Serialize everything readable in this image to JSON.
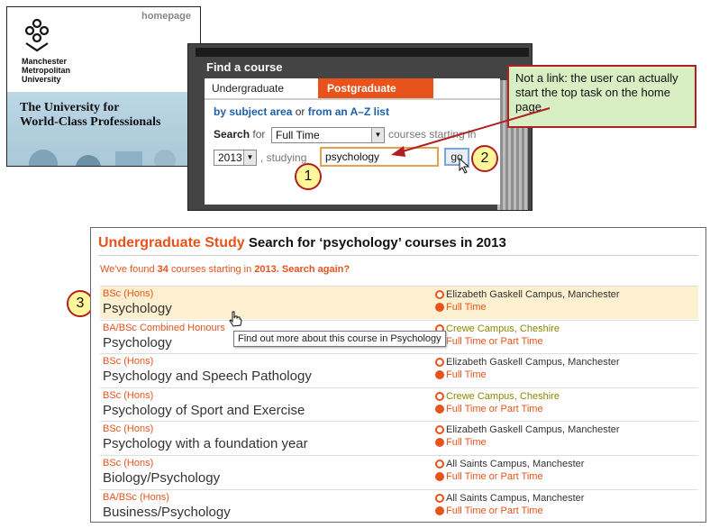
{
  "homepage": {
    "label": "homepage",
    "uni_name": [
      "Manchester",
      "Metropolitan",
      "University"
    ],
    "tagline": [
      "The University for",
      "World-Class Professionals"
    ]
  },
  "find_course": {
    "title": "Find a course",
    "tabs": [
      "Undergraduate",
      "Postgraduate"
    ],
    "links": {
      "subject": "by subject area",
      "or": "or",
      "from": "from an A–Z list"
    },
    "search_label": "Search",
    "for_label": "for",
    "mode_value": "Full Time",
    "starting_text": "courses starting in",
    "year_value": "2013",
    "studying_text": ", studying",
    "query": "psychology",
    "go_label": "go"
  },
  "callout": {
    "text": "Not a link: the user can actually start the top task on the home page."
  },
  "badges": [
    "1",
    "2",
    "3"
  ],
  "results": {
    "header_ug": "Undergraduate Study",
    "header_rest": "Search for ‘psychology’ courses in 2013",
    "found_prefix": "We've found",
    "found_count": "34",
    "found_mid": "courses starting in",
    "found_year": "2013",
    "found_again": ". Search again?",
    "tooltip": "Find out more about this course in Psychology",
    "rows": [
      {
        "degree": "BSc (Hons)",
        "name": "Psychology",
        "campus": "Elizabeth Gaskell Campus, Manchester",
        "mode": "Full Time",
        "campus_green": false
      },
      {
        "degree": "BA/BSc Combined Honours",
        "name": "Psychology",
        "campus": "Crewe Campus, Cheshire",
        "mode": "Full Time or Part Time",
        "campus_green": true
      },
      {
        "degree": "BSc (Hons)",
        "name": "Psychology and Speech Pathology",
        "campus": "Elizabeth Gaskell Campus, Manchester",
        "mode": "Full Time",
        "campus_green": false
      },
      {
        "degree": "BSc (Hons)",
        "name": "Psychology of Sport and Exercise",
        "campus": "Crewe Campus, Cheshire",
        "mode": "Full Time or Part Time",
        "campus_green": true
      },
      {
        "degree": "BSc (Hons)",
        "name": "Psychology with a foundation year",
        "campus": "Elizabeth Gaskell Campus, Manchester",
        "mode": "Full Time",
        "campus_green": false
      },
      {
        "degree": "BSc (Hons)",
        "name": "Biology/Psychology",
        "campus": "All Saints Campus, Manchester",
        "mode": "Full Time or Part Time",
        "campus_green": false
      },
      {
        "degree": "BA/BSc (Hons)",
        "name": "Business/Psychology",
        "campus": "All Saints Campus, Manchester",
        "mode": "Full Time or Part Time",
        "campus_green": false
      }
    ]
  },
  "colors": {
    "accent": "#e8531c",
    "link": "#1d5fa8",
    "callout_bg": "#d8efc4",
    "callout_border": "#b02020",
    "badge_bg": "#fff799"
  }
}
